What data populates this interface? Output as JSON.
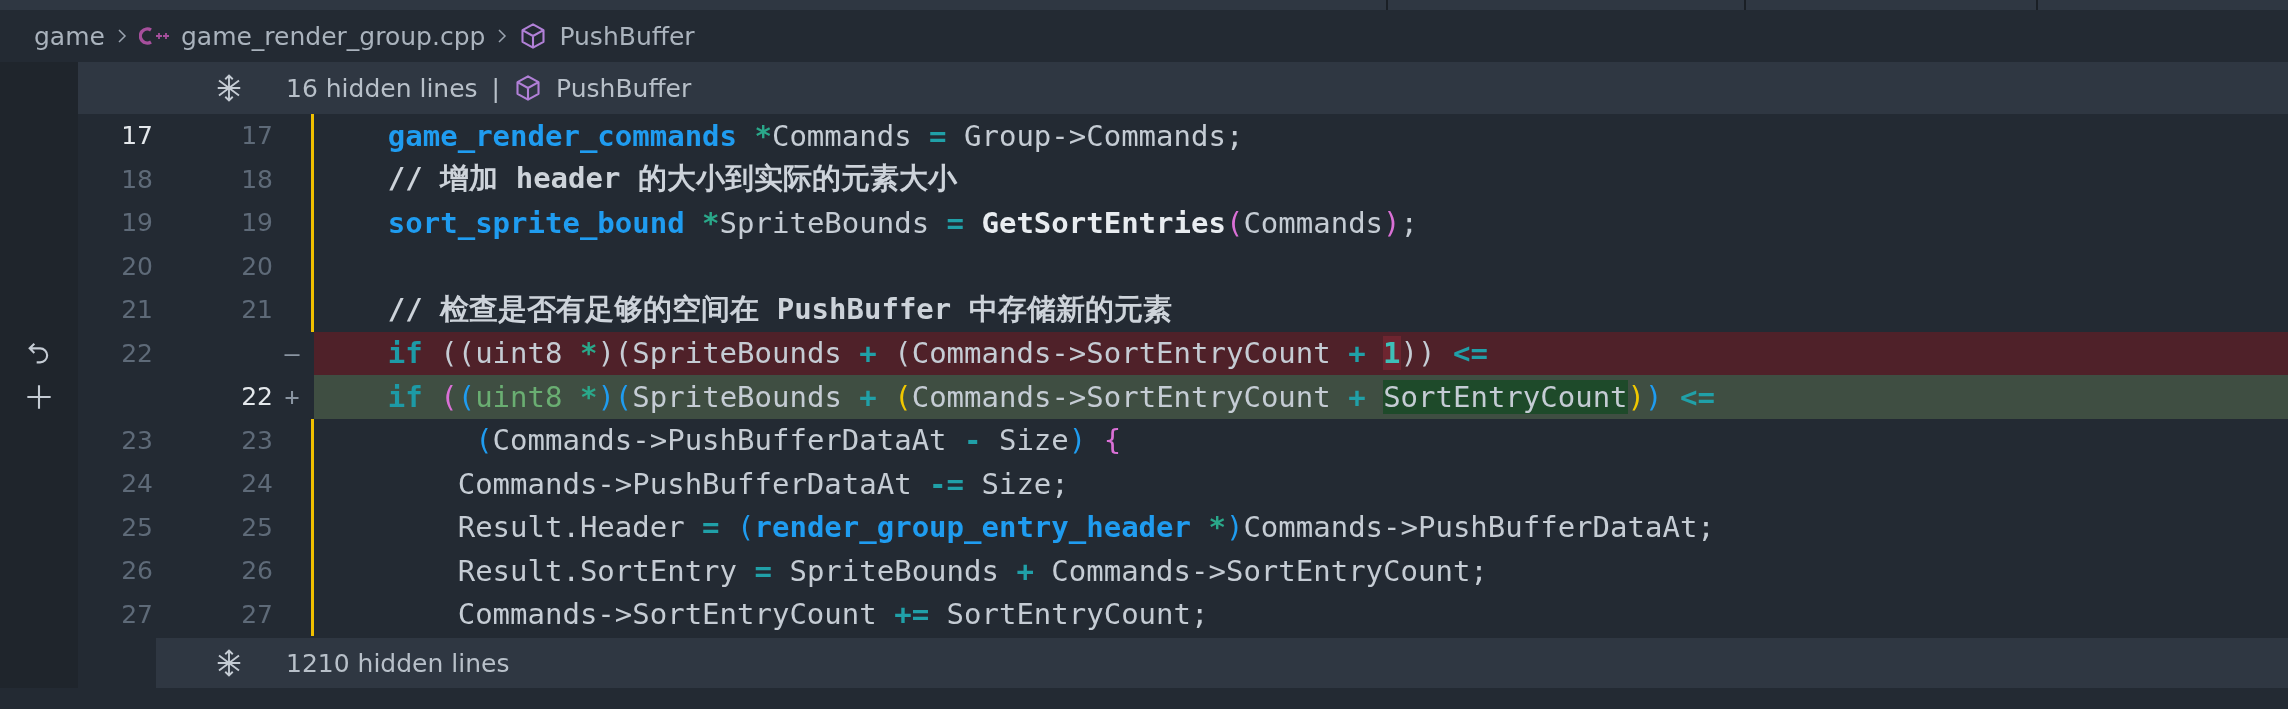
{
  "breadcrumb": [
    {
      "label": "game",
      "kind": "folder"
    },
    {
      "label": "game_render_group.cpp",
      "kind": "cpp"
    },
    {
      "label": "PushBuffer",
      "kind": "symbol"
    }
  ],
  "hidden_top": {
    "label": "16 hidden lines",
    "separator": "|",
    "symbol": "PushBuffer"
  },
  "lines": [
    {
      "old": "17",
      "new": "17",
      "kind": "context",
      "old_active": true,
      "new_active": false,
      "tokens": [
        {
          "text": "    game_render_commands",
          "kind": "type"
        },
        {
          "text": " *",
          "kind": "ptr"
        },
        {
          "text": "Commands ",
          "kind": "plain"
        },
        {
          "text": "=",
          "kind": "op"
        },
        {
          "text": " Group->Commands;",
          "kind": "plain"
        }
      ]
    },
    {
      "old": "18",
      "new": "18",
      "kind": "context",
      "old_active": false,
      "new_active": false,
      "tokens": [
        {
          "text": "    // 增加 header 的大小到实际的元素大小",
          "kind": "comment"
        }
      ]
    },
    {
      "old": "19",
      "new": "19",
      "kind": "context",
      "old_active": false,
      "new_active": false,
      "tokens": [
        {
          "text": "    sort_sprite_bound",
          "kind": "type"
        },
        {
          "text": " *",
          "kind": "ptr"
        },
        {
          "text": "SpriteBounds ",
          "kind": "plain"
        },
        {
          "text": "= ",
          "kind": "op"
        },
        {
          "text": "GetSortEntries",
          "kind": "func"
        },
        {
          "text": "(",
          "kind": "paren1"
        },
        {
          "text": "Commands",
          "kind": "plain"
        },
        {
          "text": ")",
          "kind": "paren1"
        },
        {
          "text": ";",
          "kind": "plain"
        }
      ]
    },
    {
      "old": "20",
      "new": "20",
      "kind": "context",
      "old_active": false,
      "new_active": false
    },
    {
      "old": "21",
      "new": "21",
      "kind": "context",
      "old_active": false,
      "new_active": false,
      "tokens": [
        {
          "text": "    // 检查是否有足够的空间在 PushBuffer 中存储新的元素",
          "kind": "comment"
        }
      ]
    },
    {
      "old": "22",
      "marker": "—",
      "kind": "removed",
      "old_active": false,
      "tokens": [
        {
          "text": "    if",
          "kind": "keyword"
        },
        {
          "text": " ((uint8 ",
          "kind": "plain"
        },
        {
          "text": "*",
          "kind": "ptr"
        },
        {
          "text": ")(SpriteBounds ",
          "kind": "plain"
        },
        {
          "text": "+",
          "kind": "op"
        },
        {
          "text": " (Commands->SortEntryCount ",
          "kind": "plain"
        },
        {
          "text": "+ ",
          "kind": "op"
        },
        {
          "text": "1",
          "kind": "num",
          "changed": true
        },
        {
          "text": ")) ",
          "kind": "plain"
        },
        {
          "text": "<=",
          "kind": "op"
        }
      ]
    },
    {
      "new": "22",
      "marker": "+",
      "kind": "added",
      "new_active": true,
      "tokens": [
        {
          "text": "    if ",
          "kind": "keyword"
        },
        {
          "text": "(",
          "kind": "paren1"
        },
        {
          "text": "(",
          "kind": "paren2"
        },
        {
          "text": "uint8",
          "kind": "typename"
        },
        {
          "text": " *",
          "kind": "ptr"
        },
        {
          "text": ")",
          "kind": "paren2"
        },
        {
          "text": "(",
          "kind": "paren2"
        },
        {
          "text": "SpriteBounds ",
          "kind": "plain"
        },
        {
          "text": "+ ",
          "kind": "op"
        },
        {
          "text": "(",
          "kind": "paren3"
        },
        {
          "text": "Commands->SortEntryCount ",
          "kind": "plain"
        },
        {
          "text": "+ ",
          "kind": "op"
        },
        {
          "text": "SortEntryCount",
          "kind": "plain",
          "changed": true
        },
        {
          "text": ")",
          "kind": "paren3"
        },
        {
          "text": ")",
          "kind": "paren2"
        },
        {
          "text": " <=",
          "kind": "op"
        }
      ]
    },
    {
      "old": "23",
      "new": "23",
      "kind": "context",
      "old_active": false,
      "new_active": false,
      "tokens": [
        {
          "text": "         (",
          "kind": "paren2"
        },
        {
          "text": "Commands->PushBufferDataAt ",
          "kind": "plain"
        },
        {
          "text": "-",
          "kind": "op"
        },
        {
          "text": " Size",
          "kind": "plain"
        },
        {
          "text": ")",
          "kind": "paren2"
        },
        {
          "text": " {",
          "kind": "paren1"
        }
      ]
    },
    {
      "old": "24",
      "new": "24",
      "kind": "context",
      "old_active": false,
      "new_active": false,
      "tokens": [
        {
          "text": "        Commands->PushBufferDataAt ",
          "kind": "plain"
        },
        {
          "text": "-=",
          "kind": "op"
        },
        {
          "text": " Size;",
          "kind": "plain"
        }
      ]
    },
    {
      "old": "25",
      "new": "25",
      "kind": "context",
      "old_active": false,
      "new_active": false,
      "tokens": [
        {
          "text": "        Result.Header ",
          "kind": "plain"
        },
        {
          "text": "= ",
          "kind": "op"
        },
        {
          "text": "(",
          "kind": "paren2"
        },
        {
          "text": "render_group_entry_header",
          "kind": "type"
        },
        {
          "text": " *",
          "kind": "ptr"
        },
        {
          "text": ")",
          "kind": "paren2"
        },
        {
          "text": "Commands->PushBufferDataAt;",
          "kind": "plain"
        }
      ]
    },
    {
      "old": "26",
      "new": "26",
      "kind": "context",
      "old_active": false,
      "new_active": false,
      "tokens": [
        {
          "text": "        Result.SortEntry ",
          "kind": "plain"
        },
        {
          "text": "=",
          "kind": "op"
        },
        {
          "text": " SpriteBounds ",
          "kind": "plain"
        },
        {
          "text": "+",
          "kind": "op"
        },
        {
          "text": " Commands->SortEntryCount;",
          "kind": "plain"
        }
      ]
    },
    {
      "old": "27",
      "new": "27",
      "kind": "context",
      "old_active": false,
      "new_active": false,
      "tokens": [
        {
          "text": "        Commands->SortEntryCount ",
          "kind": "plain"
        },
        {
          "text": "+=",
          "kind": "op"
        },
        {
          "text": " SortEntryCount;",
          "kind": "plain"
        }
      ]
    }
  ],
  "hidden_bottom": {
    "label": "1210 hidden lines"
  }
}
